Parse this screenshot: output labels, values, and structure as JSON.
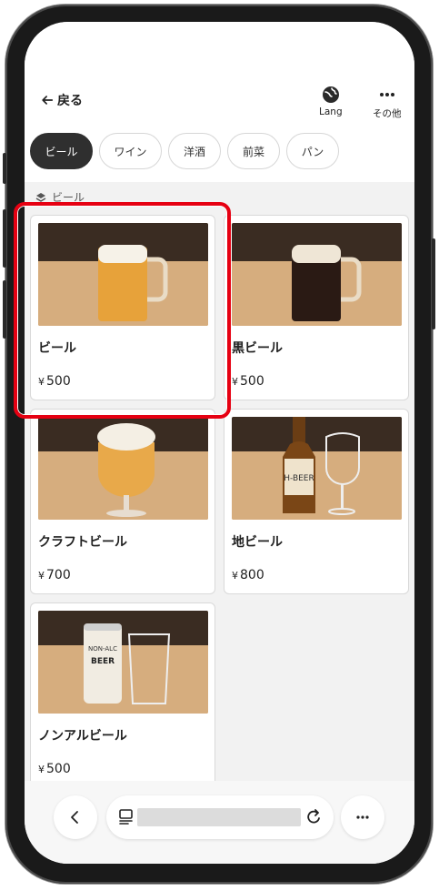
{
  "header": {
    "back_label": "戻る",
    "lang_label": "Lang",
    "more_label": "その他"
  },
  "tabs": [
    {
      "label": "ビール",
      "active": true
    },
    {
      "label": "ワイン",
      "active": false
    },
    {
      "label": "洋酒",
      "active": false
    },
    {
      "label": "前菜",
      "active": false
    },
    {
      "label": "パン",
      "active": false
    }
  ],
  "section": {
    "label": "ビール"
  },
  "products": [
    {
      "name": "ビール",
      "currency": "¥",
      "price": "500",
      "image": "beer-mug-image",
      "selected": true
    },
    {
      "name": "黒ビール",
      "currency": "¥",
      "price": "500",
      "image": "dark-beer-mug-image",
      "selected": false
    },
    {
      "name": "クラフトビール",
      "currency": "¥",
      "price": "700",
      "image": "craft-beer-glass-image",
      "selected": false
    },
    {
      "name": "地ビール",
      "currency": "¥",
      "price": "800",
      "image": "local-beer-bottle-image",
      "selected": false
    },
    {
      "name": "ノンアルビール",
      "currency": "¥",
      "price": "500",
      "image": "non-alcohol-beer-can-image",
      "selected": false
    }
  ],
  "colors": {
    "highlight": "#e60012",
    "active_tab": "#2f2f2f",
    "screen_bg": "#f2f2f2"
  }
}
